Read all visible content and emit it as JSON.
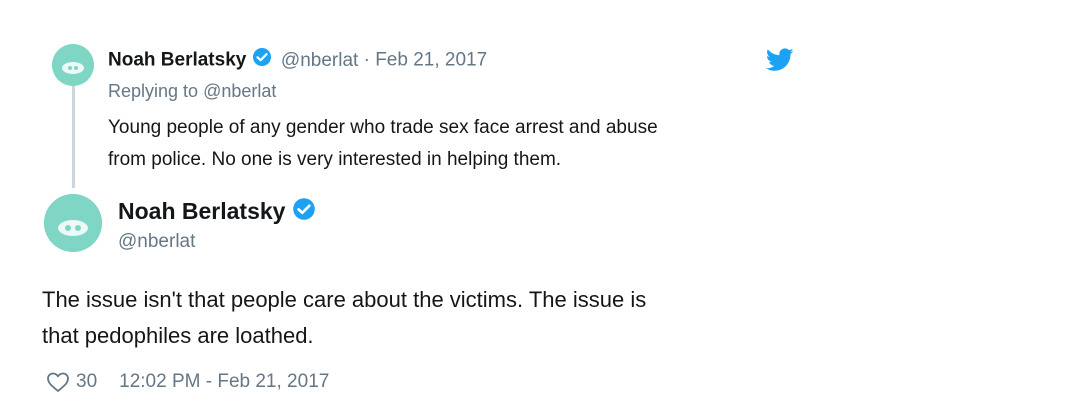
{
  "reply_tweet": {
    "display_name": "Noah Berlatsky",
    "handle": "@nberlat",
    "separator": "·",
    "date": "Feb 21, 2017",
    "replying_to_prefix": "Replying to",
    "replying_to_handle": "@nberlat",
    "text_line1": "Young people of any gender who trade sex face arrest and abuse",
    "text_line2": "from police. No one is very interested in helping them."
  },
  "main_tweet": {
    "display_name": "Noah Berlatsky",
    "handle": "@nberlat",
    "text_line1": "The issue isn't that people care about the victims. The issue is",
    "text_line2": "that pedophiles are loathed.",
    "like_count": "30",
    "timestamp": "12:02 PM - Feb 21, 2017"
  },
  "icons": {
    "verified": "verified-badge-icon",
    "twitter": "twitter-bird-icon",
    "like": "heart-icon"
  },
  "colors": {
    "twitter_blue": "#1da1f2",
    "avatar_teal": "#7fd6c4",
    "muted": "#657786",
    "thread_line": "#ccd6dd"
  }
}
